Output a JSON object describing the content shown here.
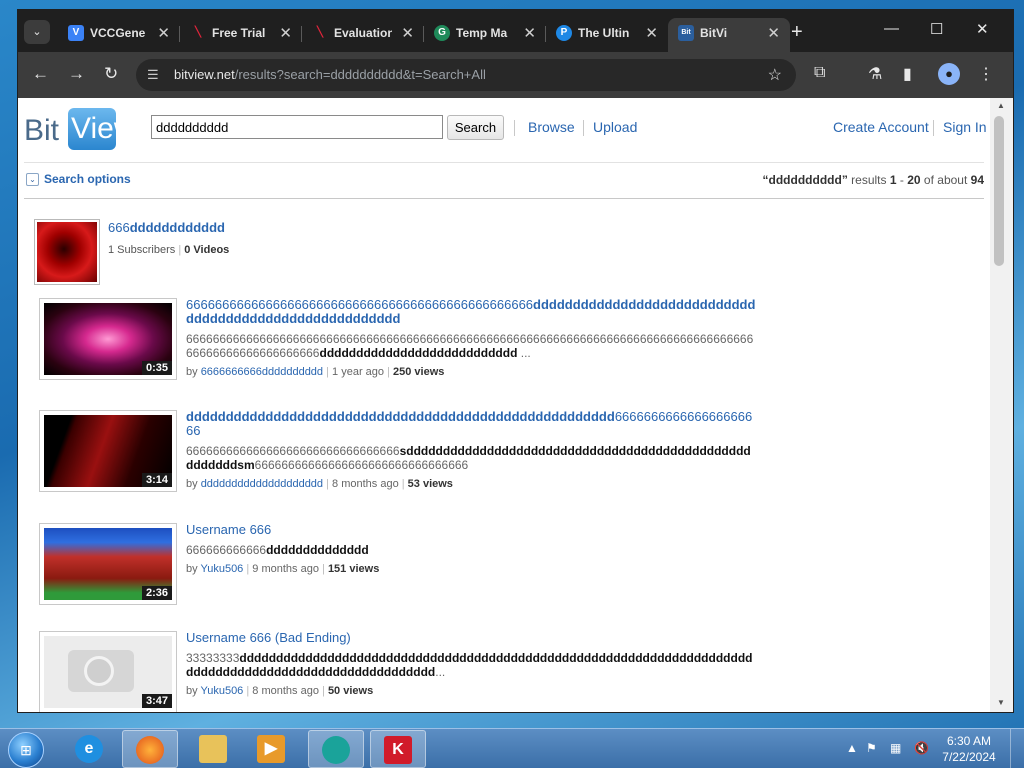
{
  "browser": {
    "tabs": [
      {
        "title": "VCCGene",
        "favicon_color": "#3b82f6",
        "favicon_text": "V"
      },
      {
        "title": "Free Trial",
        "favicon_color": "#cc1f2f",
        "favicon_text": "╲"
      },
      {
        "title": "Evaluation",
        "favicon_color": "#cc1f2f",
        "favicon_text": "╲"
      },
      {
        "title": "Temp Ma",
        "favicon_color": "#1f8a5a",
        "favicon_text": "G"
      },
      {
        "title": "The Ultin",
        "favicon_color": "#1e88e5",
        "favicon_text": "P"
      },
      {
        "title": "BitVi",
        "favicon_color": "#2b5f9e",
        "favicon_text": "Bit"
      }
    ],
    "url_host": "bitview.net",
    "url_path": "/results?search=dddddddddd&t=Search+All"
  },
  "site": {
    "logo_bit": "Bit",
    "logo_view": "View",
    "search_value": "dddddddddd",
    "search_button": "Search",
    "nav": {
      "browse": "Browse",
      "upload": "Upload",
      "create_account": "Create Account",
      "sign_in": "Sign In"
    },
    "search_options": "Search options",
    "results": {
      "query": "“dddddddddd”",
      "label": "results",
      "from": "1",
      "to": "20",
      "of_label": "of about",
      "total": "94"
    }
  },
  "channel": {
    "title_prefix": "666",
    "title_bold": "dddddddddddd",
    "subscribers": "1 Subscribers",
    "videos": "0 Videos"
  },
  "videos": [
    {
      "title_plain": "666666666666666666666666666666666666666666666666",
      "title_bold": "ddddddddddddddddddddddddddddddddddddddddddddddddddddddd",
      "desc_plain": "666666666666666666666666666666666666666666666666666666666666666666666666666666666666666666666666666666666",
      "desc_bold": "ddddddddddddddddddddddddddd",
      "desc_tail": " ...",
      "duration": "0:35",
      "author": "6666666666dddddddddd",
      "age": "1 year ago",
      "views": "250 views"
    },
    {
      "title_bold": "dddddddddddddddddddddddddddddddddddddddddddddddddddddd",
      "title_plain": "666666666666666666666",
      "desc_plain": "66666666666666666666666666666666",
      "desc_bold": "sddddddddddddddddddddddddddddddddddddddddddddddddddddddsm",
      "desc_tail": "66666666666666666666666666666666",
      "duration": "3:14",
      "author": "dddddddddddddddddddd",
      "age": "8 months ago",
      "views": "53 views"
    },
    {
      "title_plain": "Username 666",
      "desc_plain": "666666666666",
      "desc_bold": "dddddddddddddd",
      "desc_tail": "",
      "duration": "2:36",
      "author": "Yuku506",
      "age": "9 months ago",
      "views": "151 views"
    },
    {
      "title_plain": "Username 666 (Bad Ending)",
      "desc_plain": "33333333",
      "desc_bold": "dddddddddddddddddddddddddddddddddddddddddddddddddddddddddddddddddddddddddddddddddddddddddddddddddddddddd",
      "desc_tail": "...",
      "duration": "3:47",
      "author": "Yuku506",
      "age": "8 months ago",
      "views": "50 views"
    }
  ],
  "taskbar": {
    "time": "6:30 AM",
    "date": "7/22/2024"
  }
}
